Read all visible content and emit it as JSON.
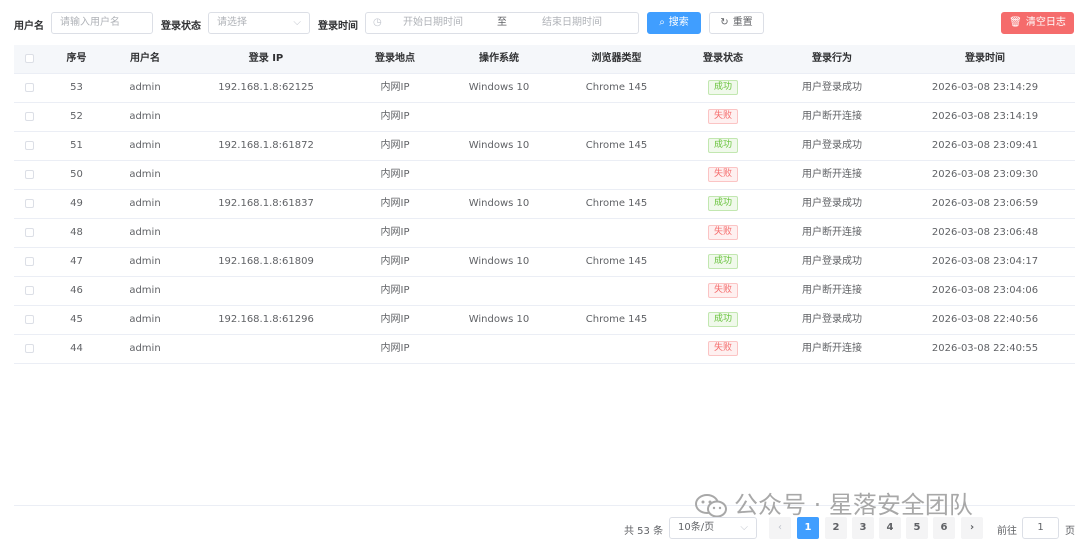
{
  "filters": {
    "username_label": "用户名",
    "username_placeholder": "请输入用户名",
    "status_label": "登录状态",
    "status_placeholder": "请选择",
    "time_label": "登录时间",
    "start_placeholder": "开始日期时间",
    "range_sep": "至",
    "end_placeholder": "结束日期时间"
  },
  "buttons": {
    "search": "搜索",
    "reset": "重置",
    "clear": "清空日志"
  },
  "colors": {
    "primary": "#409eff",
    "danger": "#f56c6c",
    "success": "#67c23a"
  },
  "columns": [
    "序号",
    "用户名",
    "登录 IP",
    "登录地点",
    "操作系统",
    "浏览器类型",
    "登录状态",
    "登录行为",
    "登录时间"
  ],
  "rows": [
    {
      "id": "53",
      "user": "admin",
      "ip": "192.168.1.8:62125",
      "loc": "内网IP",
      "os": "Windows 10",
      "browser": "Chrome 145",
      "status": "成功",
      "status_type": "ok",
      "action": "用户登录成功",
      "time": "2026-03-08 23:14:29"
    },
    {
      "id": "52",
      "user": "admin",
      "ip": "",
      "loc": "内网IP",
      "os": "",
      "browser": "",
      "status": "失败",
      "status_type": "fail",
      "action": "用户断开连接",
      "time": "2026-03-08 23:14:19"
    },
    {
      "id": "51",
      "user": "admin",
      "ip": "192.168.1.8:61872",
      "loc": "内网IP",
      "os": "Windows 10",
      "browser": "Chrome 145",
      "status": "成功",
      "status_type": "ok",
      "action": "用户登录成功",
      "time": "2026-03-08 23:09:41"
    },
    {
      "id": "50",
      "user": "admin",
      "ip": "",
      "loc": "内网IP",
      "os": "",
      "browser": "",
      "status": "失败",
      "status_type": "fail",
      "action": "用户断开连接",
      "time": "2026-03-08 23:09:30"
    },
    {
      "id": "49",
      "user": "admin",
      "ip": "192.168.1.8:61837",
      "loc": "内网IP",
      "os": "Windows 10",
      "browser": "Chrome 145",
      "status": "成功",
      "status_type": "ok",
      "action": "用户登录成功",
      "time": "2026-03-08 23:06:59"
    },
    {
      "id": "48",
      "user": "admin",
      "ip": "",
      "loc": "内网IP",
      "os": "",
      "browser": "",
      "status": "失败",
      "status_type": "fail",
      "action": "用户断开连接",
      "time": "2026-03-08 23:06:48"
    },
    {
      "id": "47",
      "user": "admin",
      "ip": "192.168.1.8:61809",
      "loc": "内网IP",
      "os": "Windows 10",
      "browser": "Chrome 145",
      "status": "成功",
      "status_type": "ok",
      "action": "用户登录成功",
      "time": "2026-03-08 23:04:17"
    },
    {
      "id": "46",
      "user": "admin",
      "ip": "",
      "loc": "内网IP",
      "os": "",
      "browser": "",
      "status": "失败",
      "status_type": "fail",
      "action": "用户断开连接",
      "time": "2026-03-08 23:04:06"
    },
    {
      "id": "45",
      "user": "admin",
      "ip": "192.168.1.8:61296",
      "loc": "内网IP",
      "os": "Windows 10",
      "browser": "Chrome 145",
      "status": "成功",
      "status_type": "ok",
      "action": "用户登录成功",
      "time": "2026-03-08 22:40:56"
    },
    {
      "id": "44",
      "user": "admin",
      "ip": "",
      "loc": "内网IP",
      "os": "",
      "browser": "",
      "status": "失败",
      "status_type": "fail",
      "action": "用户断开连接",
      "time": "2026-03-08 22:40:55"
    }
  ],
  "pagination": {
    "total_text": "共 53 条",
    "page_size": "10条/页",
    "pages": [
      "1",
      "2",
      "3",
      "4",
      "5",
      "6"
    ],
    "current_page": "1",
    "goto_label": "前往",
    "goto_value": "1",
    "page_suffix": "页"
  },
  "watermark": {
    "text": "公众号 · 星落安全团队"
  }
}
